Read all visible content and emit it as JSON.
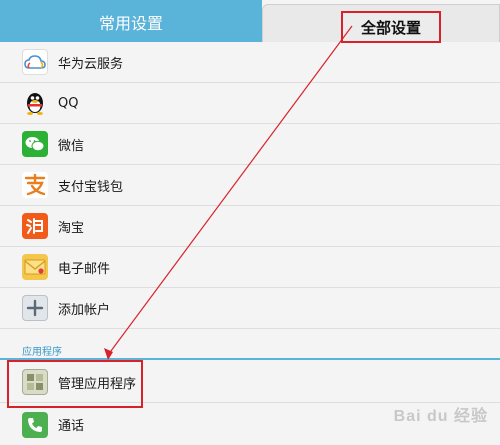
{
  "tabs": {
    "common_label": "常用设置",
    "all_label": "全部设置"
  },
  "accounts": [
    {
      "label": "华为云服务",
      "icon": "cloud-icon"
    },
    {
      "label": "QQ",
      "icon": "qq-penguin-icon"
    },
    {
      "label": "微信",
      "icon": "wechat-icon"
    },
    {
      "label": "支付宝钱包",
      "icon": "alipay-icon"
    },
    {
      "label": "淘宝",
      "icon": "taobao-icon"
    },
    {
      "label": "电子邮件",
      "icon": "email-icon"
    },
    {
      "label": "添加帐户",
      "icon": "plus-icon"
    }
  ],
  "section": {
    "title": "应用程序"
  },
  "apps": [
    {
      "label": "管理应用程序",
      "icon": "apps-grid-icon"
    },
    {
      "label": "通话",
      "icon": "phone-icon"
    }
  ],
  "annotation_color": "#d8222a",
  "accent_color": "#5ab3d8",
  "watermark": "Bai du 经验"
}
